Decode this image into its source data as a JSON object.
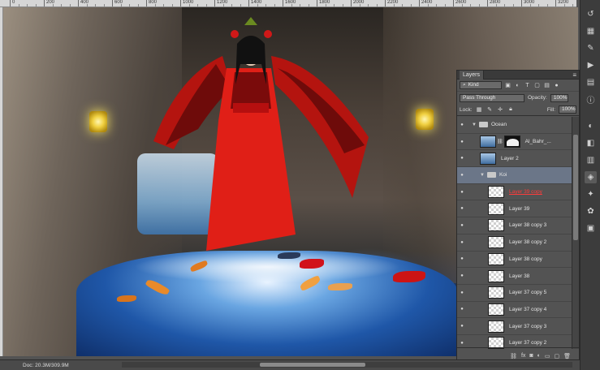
{
  "ruler": {
    "ticks": [
      "0",
      "200",
      "400",
      "600",
      "800",
      "1000",
      "1200",
      "1400",
      "1600",
      "1800",
      "2000",
      "2200",
      "2400",
      "2600",
      "2800",
      "3000",
      "3200"
    ]
  },
  "panel": {
    "tab": "Layers",
    "kind_label": "Kind",
    "blend_mode": "Pass Through",
    "opacity_label": "Opacity:",
    "opacity_value": "100%",
    "lock_label": "Lock:",
    "fill_label": "Fill:",
    "fill_value": "100%",
    "layers": [
      {
        "name": "Ocean",
        "type": "group",
        "indent": 0,
        "selected": false,
        "highlight": false
      },
      {
        "name": "Al_Bahr_...",
        "type": "image-mask",
        "indent": 1,
        "selected": false,
        "highlight": false
      },
      {
        "name": "Layer 2",
        "type": "image",
        "indent": 1,
        "selected": false,
        "highlight": false
      },
      {
        "name": "Koi",
        "type": "group",
        "indent": 1,
        "selected": true,
        "highlight": false
      },
      {
        "name": "Layer 39 copy",
        "type": "pixel",
        "indent": 2,
        "selected": false,
        "highlight": true
      },
      {
        "name": "Layer 39",
        "type": "pixel",
        "indent": 2,
        "selected": false,
        "highlight": false
      },
      {
        "name": "Layer 38 copy 3",
        "type": "pixel",
        "indent": 2,
        "selected": false,
        "highlight": false
      },
      {
        "name": "Layer 38 copy 2",
        "type": "pixel",
        "indent": 2,
        "selected": false,
        "highlight": false
      },
      {
        "name": "Layer 38 copy",
        "type": "pixel",
        "indent": 2,
        "selected": false,
        "highlight": false
      },
      {
        "name": "Layer 38",
        "type": "pixel",
        "indent": 2,
        "selected": false,
        "highlight": false
      },
      {
        "name": "Layer 37 copy 5",
        "type": "pixel",
        "indent": 2,
        "selected": false,
        "highlight": false
      },
      {
        "name": "Layer 37 copy 4",
        "type": "pixel",
        "indent": 2,
        "selected": false,
        "highlight": false
      },
      {
        "name": "Layer 37 copy 3",
        "type": "pixel",
        "indent": 2,
        "selected": false,
        "highlight": false
      },
      {
        "name": "Layer 37 copy 2",
        "type": "pixel",
        "indent": 2,
        "selected": false,
        "highlight": false
      }
    ],
    "bottom_icons": [
      "link-icon",
      "fx-icon",
      "mask-icon",
      "adjustment-icon",
      "folder-icon",
      "new-layer-icon",
      "trash-icon"
    ]
  },
  "status": {
    "doc": "Doc: 20.3M/309.9M"
  },
  "tools": [
    "history-icon",
    "swatches-icon",
    "brush-icon",
    "play-icon",
    "layers-comp-icon",
    "info-icon",
    "adjust-icon",
    "color-icon",
    "channels-icon",
    "layers-icon",
    "paths-icon",
    "styles-icon",
    "properties-icon"
  ]
}
